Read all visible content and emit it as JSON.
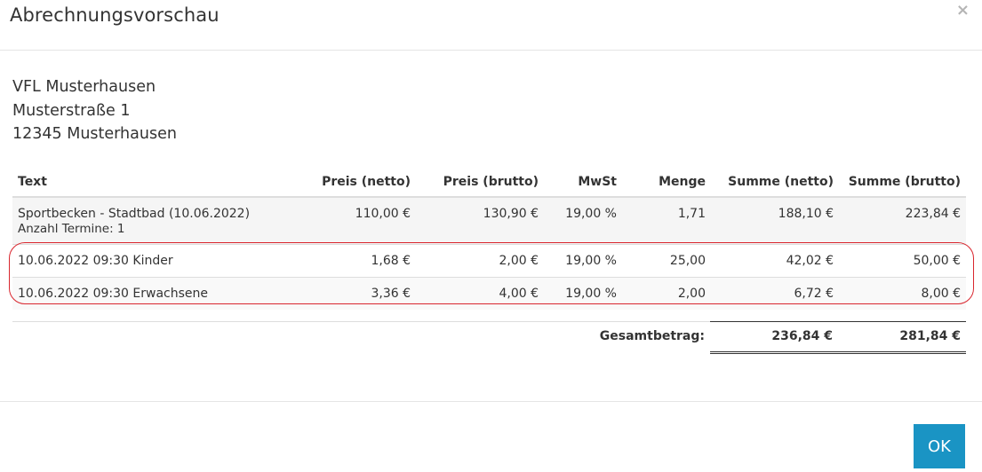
{
  "dialog": {
    "title": "Abrechnungsvorschau",
    "close_symbol": "×",
    "ok_label": "OK"
  },
  "address": {
    "name": "VFL Musterhausen",
    "street": "Musterstraße 1",
    "city": "12345 Musterhausen"
  },
  "table": {
    "headers": [
      "Text",
      "Preis (netto)",
      "Preis (brutto)",
      "MwSt",
      "Menge",
      "Summe (netto)",
      "Summe (brutto)"
    ],
    "main_row": {
      "text": "Sportbecken - Stadtbad (10.06.2022)",
      "subtext": "Anzahl Termine: 1",
      "preis_netto": "110,00 €",
      "preis_brutto": "130,90 €",
      "mwst": "19,00 %",
      "menge": "1,71",
      "summe_netto": "188,10 €",
      "summe_brutto": "223,84 €"
    },
    "rows": [
      {
        "text": "10.06.2022 09:30 Kinder",
        "preis_netto": "1,68 €",
        "preis_brutto": "2,00 €",
        "mwst": "19,00 %",
        "menge": "25,00",
        "summe_netto": "42,02 €",
        "summe_brutto": "50,00 €"
      },
      {
        "text": "10.06.2022 09:30 Erwachsene",
        "preis_netto": "3,36 €",
        "preis_brutto": "4,00 €",
        "mwst": "19,00 %",
        "menge": "2,00",
        "summe_netto": "6,72 €",
        "summe_brutto": "8,00 €"
      }
    ],
    "total": {
      "label": "Gesamtbetrag:",
      "summe_netto": "236,84 €",
      "summe_brutto": "281,84 €"
    }
  },
  "colors": {
    "ok_button": "#1a94c4",
    "highlight_outline": "#d9262e"
  }
}
